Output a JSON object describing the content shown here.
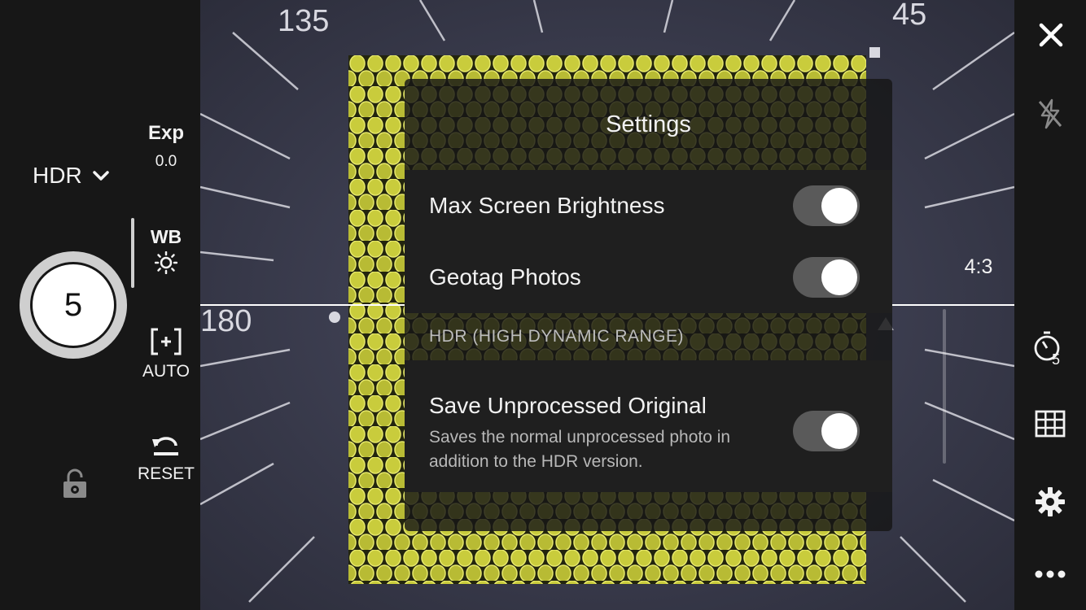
{
  "left_panel": {
    "mode": "HDR",
    "shutter_count": "5",
    "exposure": {
      "label": "Exp",
      "value": "0.0"
    },
    "white_balance": {
      "label": "WB",
      "icon": "sun-icon"
    },
    "focus": {
      "label": "AUTO",
      "icon": "focus-frame-icon"
    },
    "reset": {
      "label": "RESET",
      "icon": "undo-arrow-icon"
    },
    "lock_icon": "unlocked-gear-icon"
  },
  "viewfinder": {
    "dial_labels": [
      "135",
      "45",
      "180"
    ]
  },
  "settings": {
    "title": "Settings",
    "rows": [
      {
        "label": "Max Screen Brightness",
        "enabled": true
      },
      {
        "label": "Geotag Photos",
        "enabled": true
      }
    ],
    "section_header": "HDR (HIGH DYNAMIC RANGE)",
    "unprocessed": {
      "label": "Save Unprocessed Original",
      "description": "Saves the normal unprocessed photo in addition to the HDR version.",
      "enabled": true
    }
  },
  "right_panel": {
    "aspect_ratio": "4:3",
    "timer_value": "5",
    "icons": [
      "close-icon",
      "flash-off-icon",
      "timer-icon",
      "grid-icon",
      "gear-icon",
      "more-icon"
    ]
  },
  "colors": {
    "panel_bg": "#171717",
    "fabric_yellow": "#c9cc3c",
    "toggle_track": "#5a5a5a"
  }
}
